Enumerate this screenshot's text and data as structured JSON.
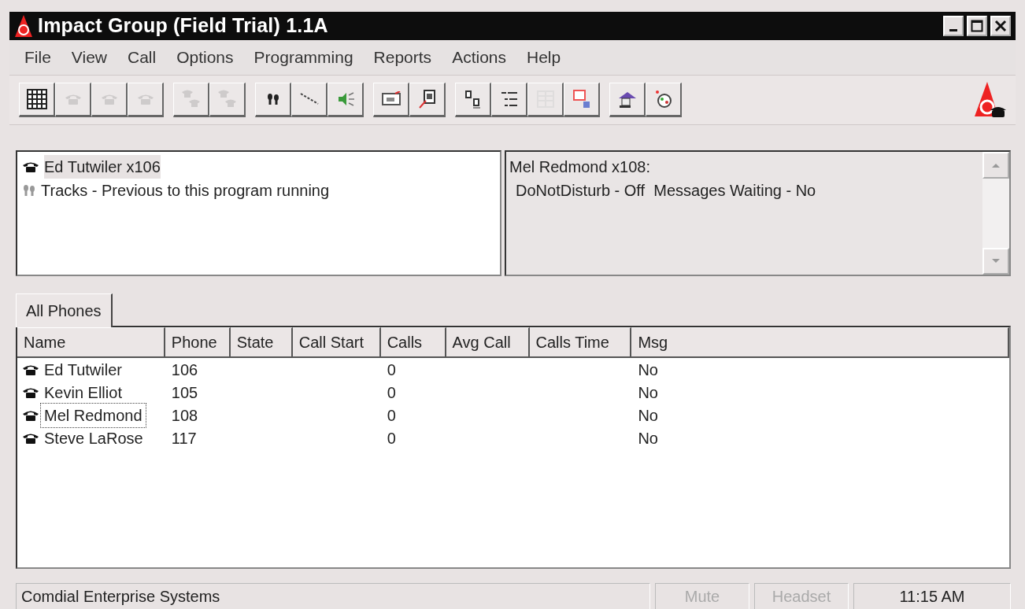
{
  "window": {
    "title": "Impact Group (Field Trial) 1.1A",
    "controls": [
      {
        "kind": "minimize"
      },
      {
        "kind": "maximize"
      },
      {
        "kind": "close"
      }
    ]
  },
  "menu": [
    {
      "label": "File"
    },
    {
      "label": "View"
    },
    {
      "label": "Call"
    },
    {
      "label": "Options"
    },
    {
      "label": "Programming"
    },
    {
      "label": "Reports"
    },
    {
      "label": "Actions"
    },
    {
      "label": "Help"
    }
  ],
  "toolbar": [
    [
      {
        "kind": "grid",
        "disabled": false
      },
      {
        "kind": "phone",
        "disabled": true
      },
      {
        "kind": "phone",
        "disabled": true
      },
      {
        "kind": "phone",
        "disabled": true
      }
    ],
    [
      {
        "kind": "transfer",
        "disabled": true
      },
      {
        "kind": "transfer",
        "disabled": true
      }
    ],
    [
      {
        "kind": "tracks",
        "disabled": false
      },
      {
        "kind": "line",
        "disabled": false
      },
      {
        "kind": "speaker",
        "disabled": false
      }
    ],
    [
      {
        "kind": "monitor",
        "disabled": false
      },
      {
        "kind": "search",
        "disabled": false
      }
    ],
    [
      {
        "kind": "label",
        "disabled": false
      },
      {
        "kind": "list",
        "disabled": false
      },
      {
        "kind": "table",
        "disabled": true
      },
      {
        "kind": "window",
        "disabled": false
      }
    ],
    [
      {
        "kind": "home",
        "disabled": false
      },
      {
        "kind": "dial",
        "disabled": false
      }
    ]
  ],
  "activity": [
    {
      "kind": "phone",
      "text": "Ed Tutwiler x106",
      "selected": true
    },
    {
      "kind": "tracks",
      "text": "Tracks - Previous to this program running",
      "selected": false
    }
  ],
  "details": {
    "heading": "Mel Redmond x108:",
    "lines": [
      "DoNotDisturb - Off  Messages Waiting - No"
    ]
  },
  "tabs": [
    {
      "label": "All Phones",
      "selected": true
    }
  ],
  "table": {
    "columns": [
      "Name",
      "Phone",
      "State",
      "Call Start",
      "Calls",
      "Avg Call",
      "Calls Time",
      "Msg"
    ],
    "rows": [
      {
        "cells": [
          "Ed Tutwiler",
          "106",
          "",
          "",
          "0",
          "",
          "",
          "No"
        ],
        "focused": false
      },
      {
        "cells": [
          "Kevin Elliot",
          "105",
          "",
          "",
          "0",
          "",
          "",
          "No"
        ],
        "focused": false
      },
      {
        "cells": [
          "Mel Redmond",
          "108",
          "",
          "",
          "0",
          "",
          "",
          "No"
        ],
        "focused": true
      },
      {
        "cells": [
          "Steve LaRose",
          "117",
          "",
          "",
          "0",
          "",
          "",
          "No"
        ],
        "focused": false
      }
    ]
  },
  "status_bar": [
    {
      "text": "Comdial Enterprise Systems",
      "disabled": false
    },
    {
      "text": "Mute",
      "disabled": true
    },
    {
      "text": "Headset",
      "disabled": true
    },
    {
      "text": "11:15 AM",
      "disabled": false
    }
  ]
}
